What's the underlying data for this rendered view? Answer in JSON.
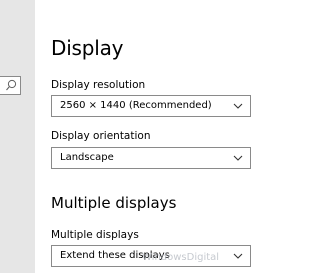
{
  "window": {
    "sidebar_color": "#e6e6e6",
    "search_icon": "search-icon"
  },
  "page": {
    "title": "Display"
  },
  "settings": {
    "resolution": {
      "label": "Display resolution",
      "value": "2560 × 1440 (Recommended)",
      "icon": "chevron-down-icon"
    },
    "orientation": {
      "label": "Display orientation",
      "value": "Landscape",
      "icon": "chevron-down-icon"
    }
  },
  "multiple_displays": {
    "heading": "Multiple displays",
    "label": "Multiple displays",
    "value": "Extend these displays",
    "icon": "chevron-down-icon"
  },
  "watermark": {
    "text": "WindowsDigital"
  }
}
